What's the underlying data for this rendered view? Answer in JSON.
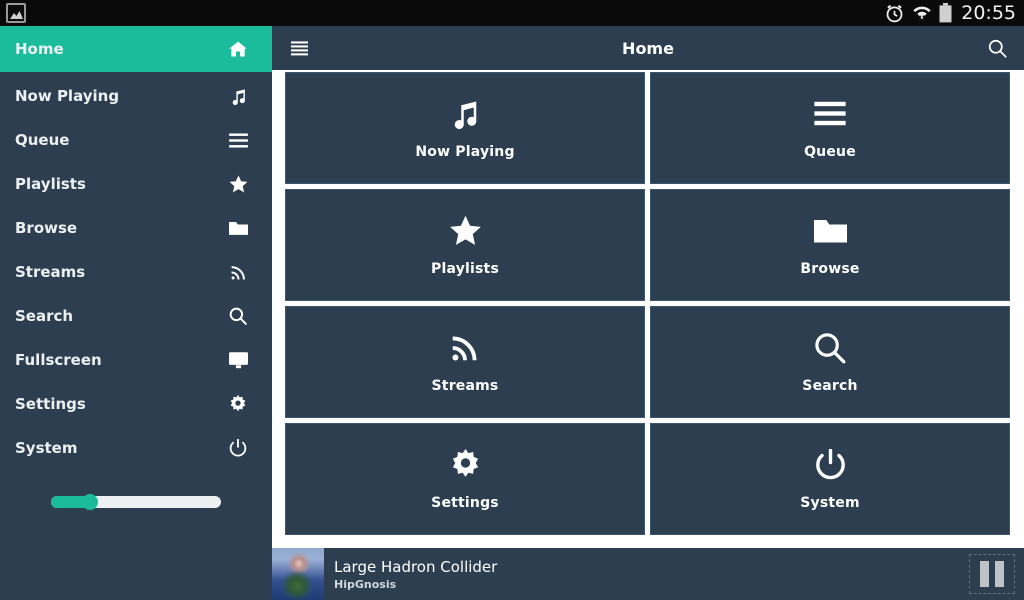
{
  "statusbar": {
    "notification_icon": "image-icon",
    "alarm_icon": "alarm-clock-icon",
    "wifi_icon": "wifi-transfer-icon",
    "battery_icon": "battery-icon",
    "clock": "20:55"
  },
  "sidebar": {
    "active_color": "#1abc9c",
    "background_color": "#2c3e50",
    "items": [
      {
        "label": "Home",
        "icon": "home-icon",
        "active": true
      },
      {
        "label": "Now Playing",
        "icon": "music-note-icon",
        "active": false
      },
      {
        "label": "Queue",
        "icon": "list-icon",
        "active": false
      },
      {
        "label": "Playlists",
        "icon": "star-icon",
        "active": false
      },
      {
        "label": "Browse",
        "icon": "folder-icon",
        "active": false
      },
      {
        "label": "Streams",
        "icon": "rss-icon",
        "active": false
      },
      {
        "label": "Search",
        "icon": "search-icon",
        "active": false
      },
      {
        "label": "Fullscreen",
        "icon": "monitor-icon",
        "active": false
      },
      {
        "label": "Settings",
        "icon": "gear-icon",
        "active": false
      },
      {
        "label": "System",
        "icon": "power-icon",
        "active": false
      }
    ],
    "volume": {
      "value_percent": 23
    }
  },
  "topbar": {
    "menu_icon": "hamburger-menu-icon",
    "title": "Home",
    "search_icon": "search-icon"
  },
  "tiles": [
    {
      "label": "Now Playing",
      "icon": "music-note-icon"
    },
    {
      "label": "Queue",
      "icon": "list-icon"
    },
    {
      "label": "Playlists",
      "icon": "star-icon"
    },
    {
      "label": "Browse",
      "icon": "folder-icon"
    },
    {
      "label": "Streams",
      "icon": "rss-icon"
    },
    {
      "label": "Search",
      "icon": "search-icon"
    },
    {
      "label": "Settings",
      "icon": "gear-icon"
    },
    {
      "label": "System",
      "icon": "power-icon"
    }
  ],
  "player": {
    "album_art": "album-art-thumbnail",
    "title": "Large Hadron Collider",
    "artist": "HipGnosis",
    "transport_icon": "pause-icon"
  }
}
